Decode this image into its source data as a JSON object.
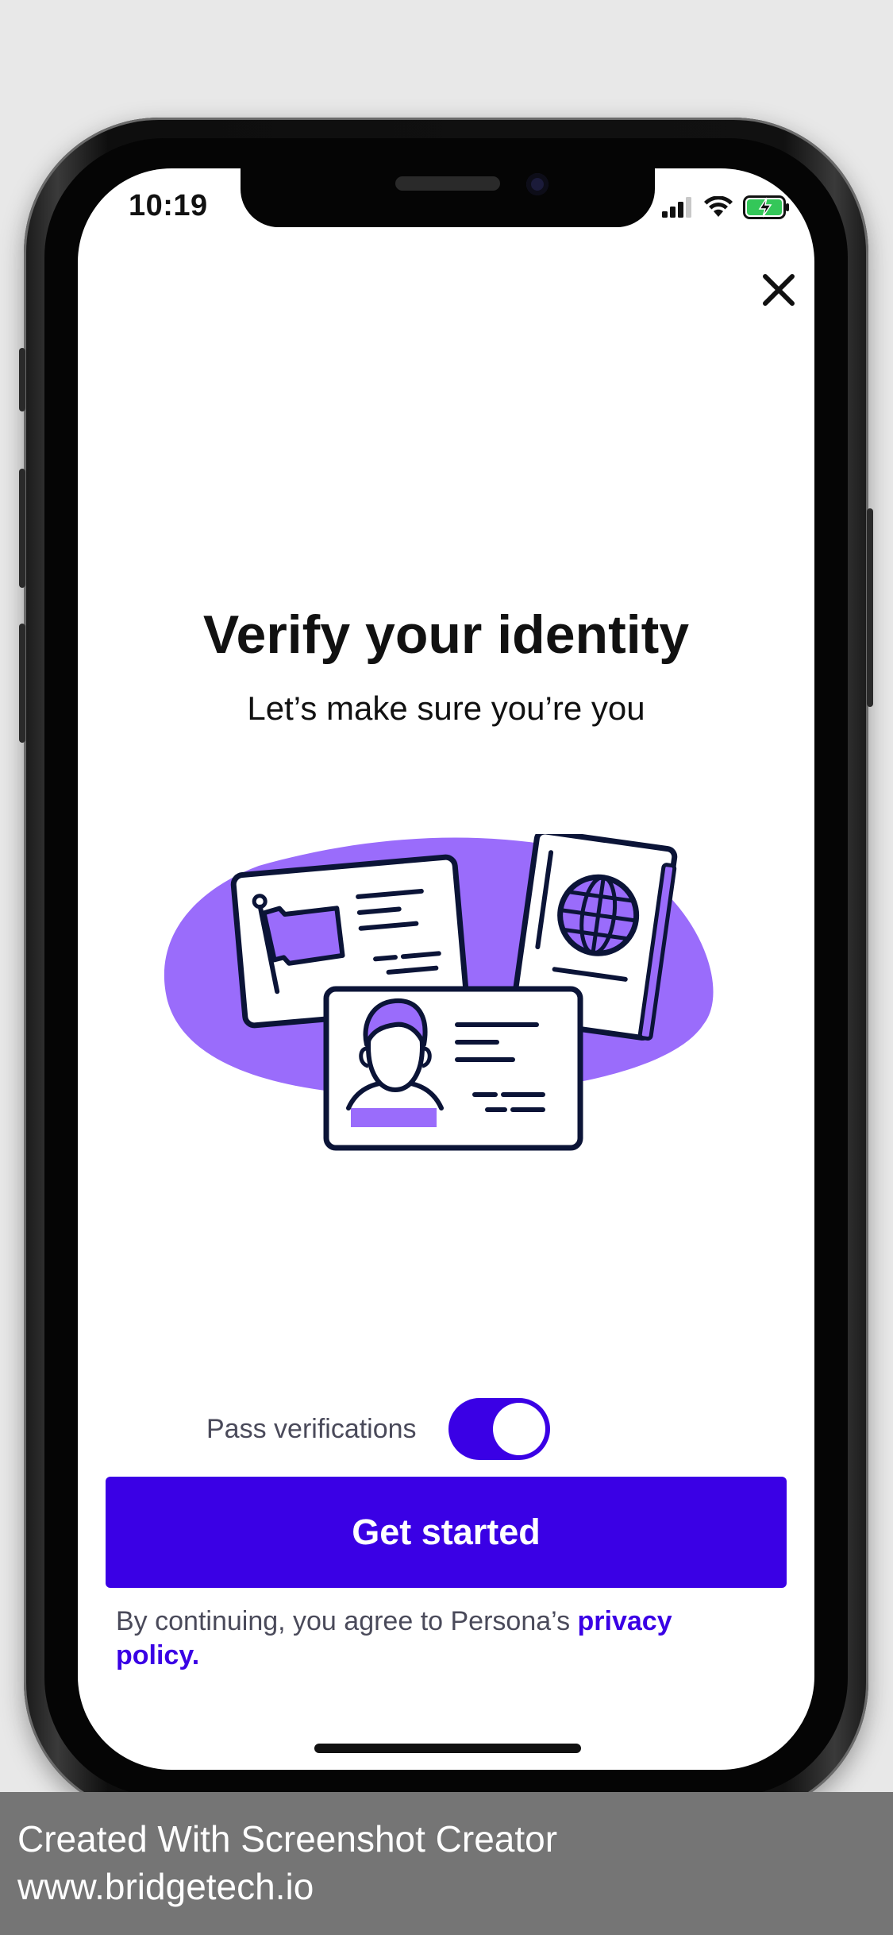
{
  "status_bar": {
    "time": "10:19"
  },
  "page": {
    "title": "Verify your identity",
    "subtitle": "Let’s make sure you’re you"
  },
  "toggle": {
    "label": "Pass verifications",
    "enabled": true
  },
  "cta": {
    "label": "Get started"
  },
  "legal": {
    "prefix": "By continuing, you agree to Persona’s ",
    "link": "privacy policy."
  },
  "footer": {
    "line1": "Created With Screenshot Creator",
    "line2": "www.bridgetech.io"
  },
  "colors": {
    "accent": "#3a00e5",
    "illustration": "#9a6cfb",
    "outline": "#0b1437"
  },
  "icons": [
    "close-icon",
    "signal-icon",
    "wifi-icon",
    "battery-charging-icon"
  ]
}
